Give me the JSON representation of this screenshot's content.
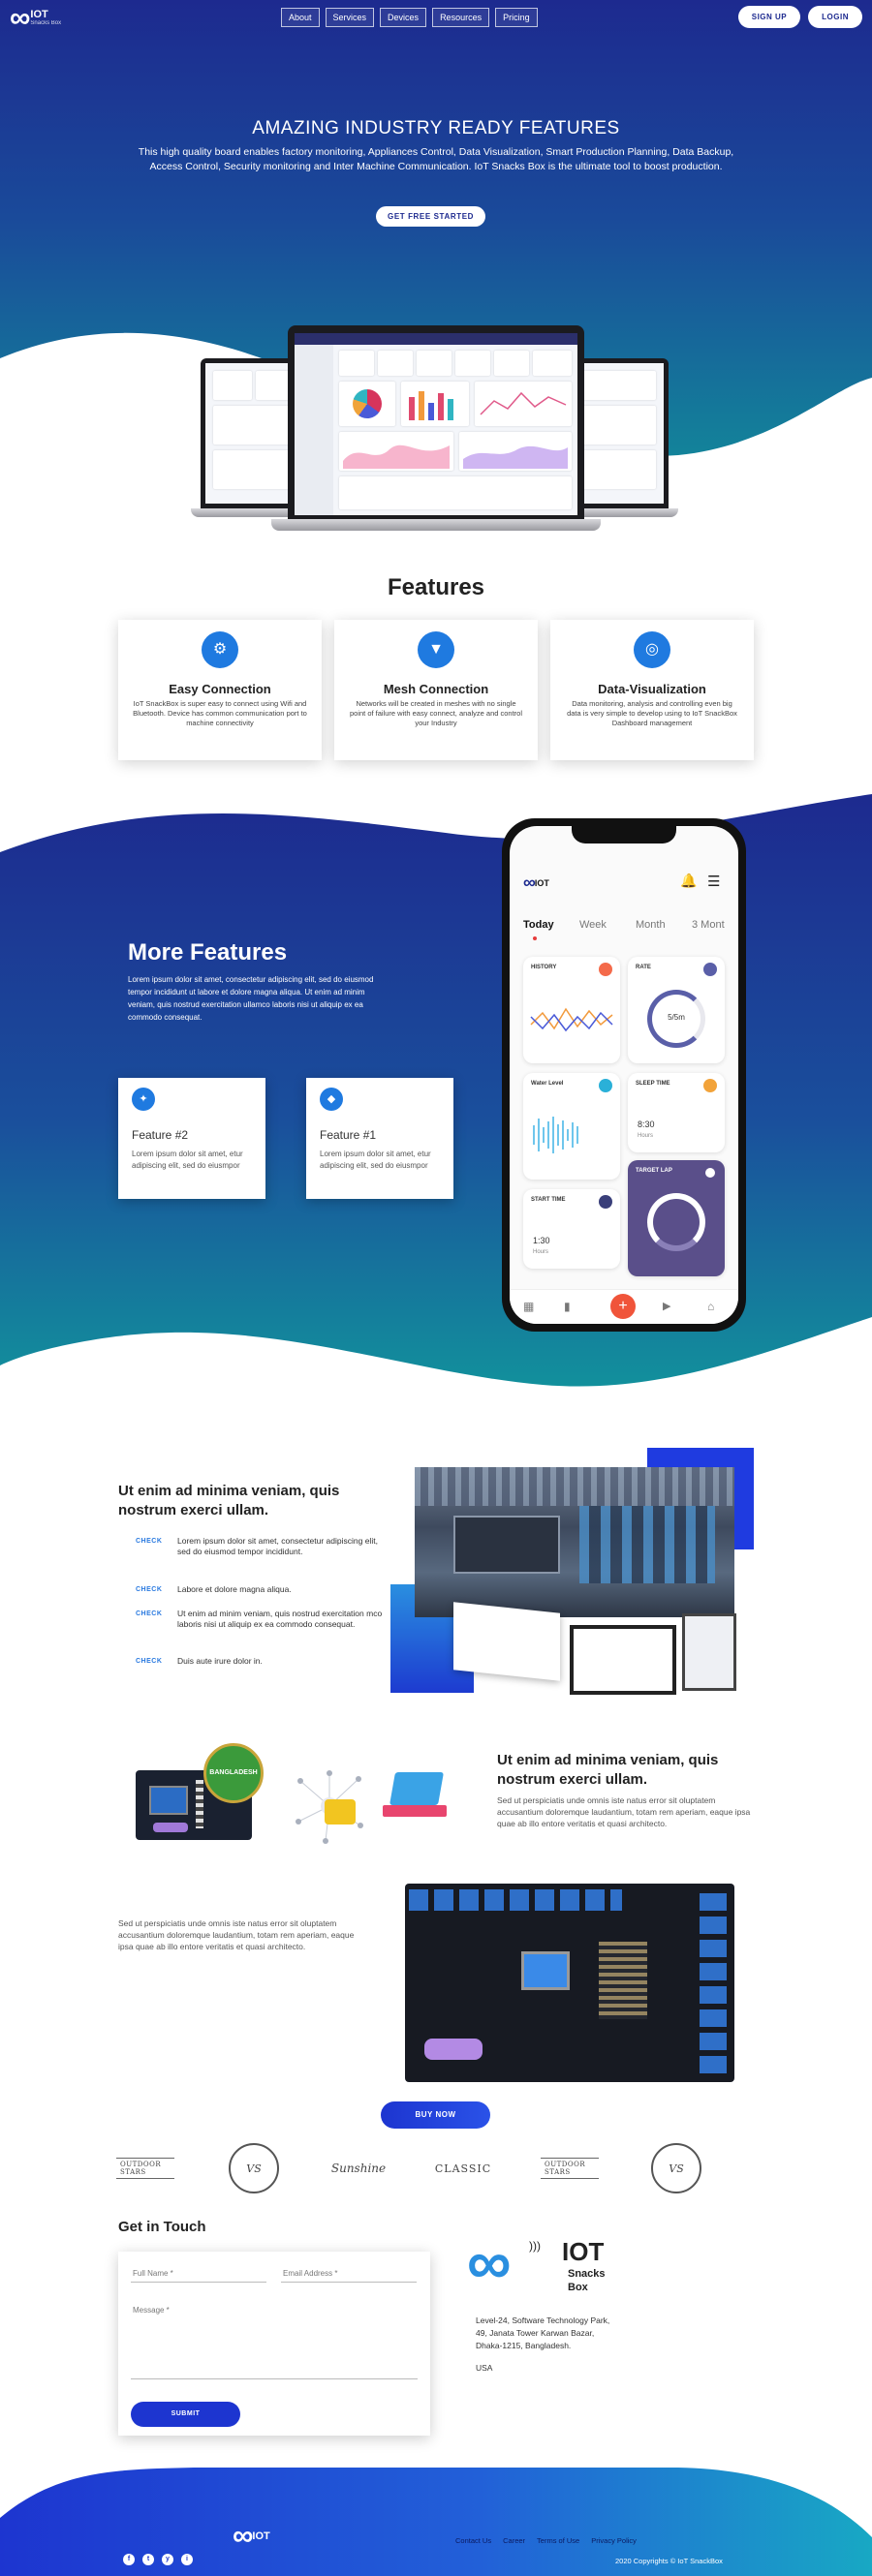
{
  "header": {
    "logo_title": "IOT",
    "logo_sub": "Snacks Box",
    "nav": [
      "About",
      "Services",
      "Devices",
      "Resources",
      "Pricing"
    ],
    "signup": "SIGN UP",
    "login": "LOGIN"
  },
  "hero": {
    "title": "AMAZING INDUSTRY READY FEATURES",
    "description": "This high quality board enables factory monitoring, Appliances Control, Data Visualization, Smart Production Planning, Data Backup, Access Control, Security monitoring and Inter Machine Communication. IoT Snacks Box is the ultimate tool to boost production.",
    "cta": "GET FREE STARTED"
  },
  "features": {
    "title": "Features",
    "cards": [
      {
        "icon": "plug-icon",
        "title": "Easy Connection",
        "text": "IoT SnackBox is super easy to connect using Wifi and Bluetooth. Device has common communication port to machine connectivity"
      },
      {
        "icon": "mesh-icon",
        "title": "Mesh Connection",
        "text": "Networks will be created in meshes with no single point of failure with easy connect, analyze and control your Industry"
      },
      {
        "icon": "chart-icon",
        "title": "Data-Visualization",
        "text": "Data monitoring, analysis and controlling even big data is very simple to develop using to IoT SnackBox Dashboard management"
      }
    ]
  },
  "more": {
    "title": "More Features",
    "description": "Lorem ipsum dolor sit amet, consectetur adipiscing elit, sed do eiusmod tempor incididunt ut labore et dolore magna aliqua. Ut enim ad minim veniam, quis nostrud exercitation ullamco laboris nisi ut aliquip ex ea commodo consequat.",
    "cards": [
      {
        "title": "Feature #2",
        "text": "Lorem ipsum dolor sit amet, etur adipiscing elit, sed do eiusmpor"
      },
      {
        "title": "Feature #1",
        "text": "Lorem ipsum dolor sit amet, etur adipiscing elit, sed do eiusmpor"
      }
    ]
  },
  "phone": {
    "logo": "IOT",
    "tabs": [
      "Today",
      "Week",
      "Month",
      "3 Mont"
    ],
    "cards": {
      "history": "HISTORY",
      "rate": "RATE",
      "rate_value": "5/5m",
      "water": "Water Level",
      "sleep": "SLEEP TIME",
      "sleep_value": "8:30",
      "sleep_unit": "Hours",
      "target": "TARGET LAP",
      "start": "START TIME",
      "start_value": "1:30",
      "start_unit": "Hours"
    }
  },
  "section1": {
    "title": "Ut enim ad minima veniam, quis nostrum exerci ullam.",
    "check": "CHECK",
    "items": [
      "Lorem ipsum dolor sit amet, consectetur adipiscing elit, sed do eiusmod tempor incididunt.",
      "Labore et dolore magna aliqua.",
      "Ut enim ad minim veniam, quis nostrud exercitation mco laboris nisi ut aliquip ex ea commodo consequat.",
      "Duis aute irure dolor in."
    ]
  },
  "section2": {
    "title": "Ut enim ad minima veniam, quis nostrum exerci ullam.",
    "text": "Sed ut perspiciatis unde omnis iste natus error sit oluptatem accusantium doloremque laudantium, totam rem aperiam, eaque ipsa quae ab illo entore veritatis et quasi architecto.",
    "badge": "BANGLADESH"
  },
  "section3": {
    "text": "Sed ut perspiciatis unde omnis iste natus error sit oluptatem accusantium doloremque laudantium, totam rem aperiam, eaque ipsa quae ab illo entore veritatis et quasi architecto.",
    "buy": "BUY NOW"
  },
  "brands": [
    "OUTDOOR STARS",
    "VS",
    "Sunshine",
    "CLASSIC",
    "OUTDOOR STARS",
    "VS"
  ],
  "contact": {
    "title": "Get in Touch",
    "full_name": "Full Name *",
    "email": "Email Address *",
    "message": "Message *",
    "submit": "SUBMIT",
    "logo_title": "IOT",
    "logo_sub1": "Snacks",
    "logo_sub2": "Box",
    "address_lines": [
      "Level-24, Software Technology Park,",
      "49, Janata Tower Karwan Bazar,",
      "Dhaka-1215, Bangladesh.",
      "",
      "USA"
    ]
  },
  "footer": {
    "links": [
      "Contact Us",
      "Career",
      "Terms of Use",
      "Privacy Policy"
    ],
    "copyright": "2020 Copyrights © IoT SnackBox",
    "social": [
      "f",
      "t",
      "y",
      "i"
    ]
  },
  "colors": {
    "primary": "#1d2a8f",
    "accent": "#1f7ae0",
    "teal": "#128a9a"
  }
}
